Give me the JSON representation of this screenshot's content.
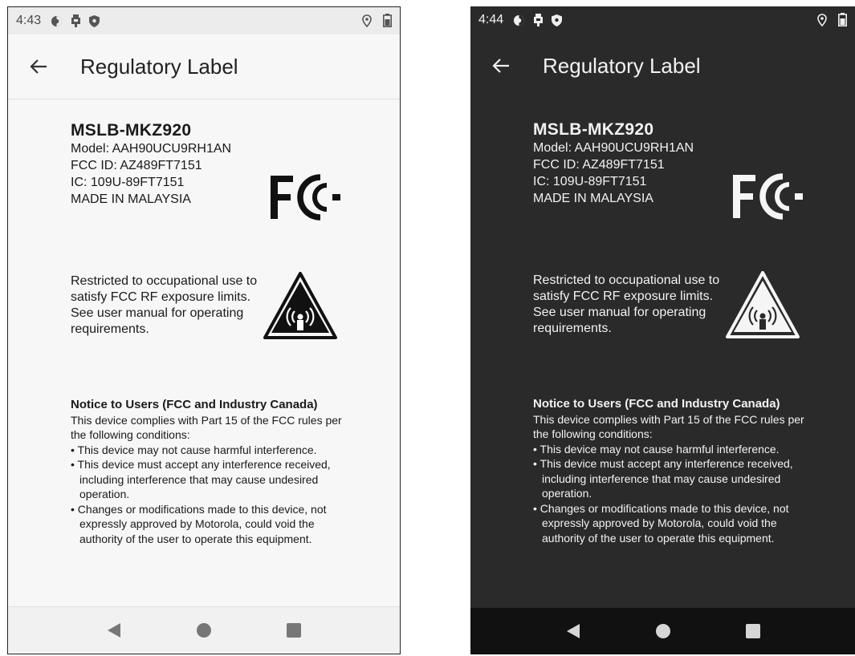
{
  "screens": {
    "light": {
      "time": "4:43"
    },
    "dark": {
      "time": "4:44"
    }
  },
  "app": {
    "title": "Regulatory Label"
  },
  "label": {
    "model_name": "MSLB-MKZ920",
    "model": "Model: AAH90UCU9RH1AN",
    "fcc_id": "FCC ID: AZ489FT7151",
    "ic": "IC: 109U-89FT7151",
    "origin": "MADE IN MALAYSIA",
    "warning": "Restricted to occupational use to satisfy FCC RF exposure limits. See user manual for operating requirements.",
    "notice_title": "Notice to Users (FCC and Industry Canada)",
    "notice_intro": "This device complies with Part 15 of the FCC rules per the following conditions:",
    "bullets": [
      "• This device may not cause harmful interference.",
      "• This device must accept any interference received, including interference that may cause undesired operation.",
      "• Changes or modifications made to this device, not expressly approved by Motorola, could void the authority of the user to operate this equipment."
    ]
  },
  "icons": [
    "back-arrow-icon",
    "fcc-logo-icon",
    "rf-warning-icon",
    "nav-back-icon",
    "nav-home-icon",
    "nav-recents-icon"
  ],
  "colors": {
    "light_bg": "#f7f7f7",
    "dark_bg": "#2a2a2a",
    "dark_nav": "#111111"
  }
}
